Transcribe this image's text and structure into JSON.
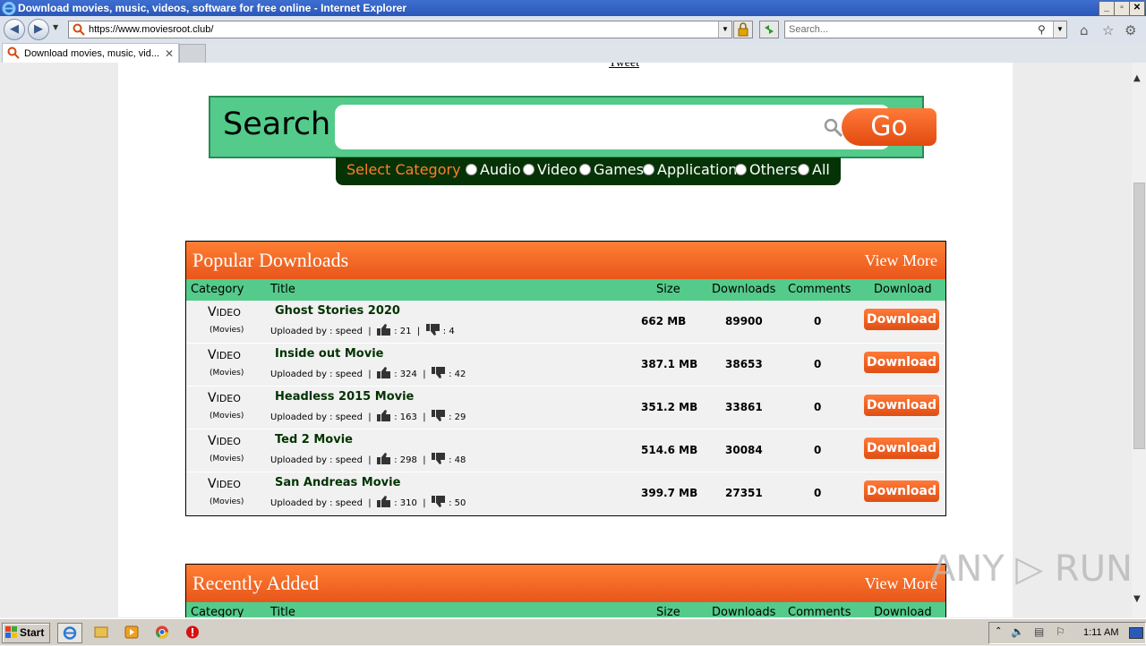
{
  "window": {
    "title": "Download movies, music, videos, software for free online - Internet Explorer",
    "min_label": "_",
    "max_label": "▫",
    "close_label": "✕"
  },
  "addressbar": {
    "url": "https://www.moviesroot.club/",
    "search_placeholder": "Search..."
  },
  "tabs": [
    {
      "label": "Download movies, music, vid...",
      "close": "✕"
    }
  ],
  "page": {
    "tweet": "Tweet",
    "search": {
      "label": "Search",
      "go": "Go",
      "select_category": "Select Category",
      "categories": [
        "Audio",
        "Video",
        "Games",
        "Application",
        "Others",
        "All"
      ]
    },
    "columns": {
      "category": "Category",
      "title": "Title",
      "size": "Size",
      "downloads": "Downloads",
      "comments": "Comments",
      "download": "Download"
    },
    "popular": {
      "heading": "Popular Downloads",
      "view_more": "View More",
      "rows": [
        {
          "cat_first": "V",
          "cat_rest": "IDEO",
          "sub": "(Movies)",
          "title": "Ghost Stories 2020",
          "uploaded": "Uploaded by : speed",
          "likes": ": 21",
          "dislikes": ": 4",
          "size": "662 MB",
          "downloads": "89900",
          "comments": "0",
          "button": "Download"
        },
        {
          "cat_first": "V",
          "cat_rest": "IDEO",
          "sub": "(Movies)",
          "title": "Inside out Movie",
          "uploaded": "Uploaded by : speed",
          "likes": ": 324",
          "dislikes": ": 42",
          "size": "387.1 MB",
          "downloads": "38653",
          "comments": "0",
          "button": "Download"
        },
        {
          "cat_first": "V",
          "cat_rest": "IDEO",
          "sub": "(Movies)",
          "title": "Headless 2015 Movie",
          "uploaded": "Uploaded by : speed",
          "likes": ": 163",
          "dislikes": ": 29",
          "size": "351.2 MB",
          "downloads": "33861",
          "comments": "0",
          "button": "Download"
        },
        {
          "cat_first": "V",
          "cat_rest": "IDEO",
          "sub": "(Movies)",
          "title": "Ted 2 Movie",
          "uploaded": "Uploaded by : speed",
          "likes": ": 298",
          "dislikes": ": 48",
          "size": "514.6 MB",
          "downloads": "30084",
          "comments": "0",
          "button": "Download"
        },
        {
          "cat_first": "V",
          "cat_rest": "IDEO",
          "sub": "(Movies)",
          "title": "San Andreas Movie",
          "uploaded": "Uploaded by : speed",
          "likes": ": 310",
          "dislikes": ": 50",
          "size": "399.7 MB",
          "downloads": "27351",
          "comments": "0",
          "button": "Download"
        }
      ]
    },
    "recent": {
      "heading": "Recently Added",
      "view_more": "View More"
    }
  },
  "watermark": "ANY ▷ RUN",
  "taskbar": {
    "start": "Start",
    "clock": "1:11 AM"
  },
  "colors": {
    "accent_orange": "#e8561a",
    "accent_green": "#54cb8a",
    "dark_green": "#053305"
  }
}
